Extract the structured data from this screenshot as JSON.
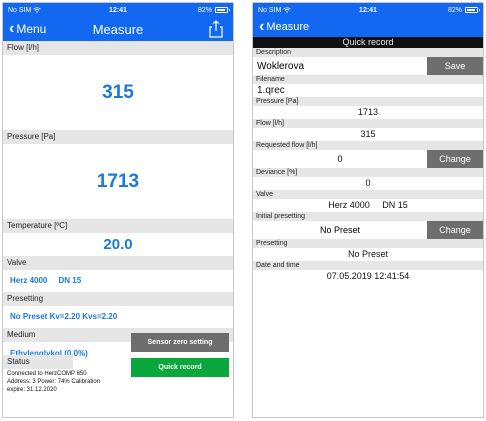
{
  "left": {
    "status": {
      "carrier": "No SIM",
      "time": "12:41",
      "battery": "82%"
    },
    "nav": {
      "back_label": "Menu",
      "title": "Measure"
    },
    "flow": {
      "label": "Flow [l/h]",
      "value": "315"
    },
    "pressure": {
      "label": "Pressure [Pa]",
      "value": "1713"
    },
    "temperature": {
      "label": "Temperature [ºC]",
      "value": "20.0"
    },
    "valve": {
      "label": "Valve",
      "value": "Herz 4000     DN 15"
    },
    "presetting": {
      "label": "Presetting",
      "value": "No Preset Kv=2.20 Kvs=2.20"
    },
    "medium": {
      "label": "Medium",
      "value": "Ethylenglykol (0.0%)"
    },
    "sensor_button": "Sensor zero setting",
    "status_section": {
      "label": "Status",
      "line1": "Connected to HerzCOMP 650",
      "line2": "Address: 3 Power: 74% Calibration",
      "line3": "expire: 31.12.2020"
    },
    "quick_button": "Quick record"
  },
  "right": {
    "status": {
      "carrier": "No SIM",
      "time": "12:41",
      "battery": "82%"
    },
    "nav": {
      "back_label": "Measure"
    },
    "header": "Quick record",
    "description": {
      "label": "Description",
      "value": "Woklerova",
      "button": "Save"
    },
    "filename": {
      "label": "Filename",
      "value": "1.qrec"
    },
    "pressure": {
      "label": "Pressure [Pa]",
      "value": "1713"
    },
    "flow": {
      "label": "Flow [l/h]",
      "value": "315"
    },
    "requested_flow": {
      "label": "Requested flow [l/h]",
      "value": "0",
      "button": "Change"
    },
    "deviance": {
      "label": "Deviance [%]",
      "value": "0"
    },
    "valve": {
      "label": "Valve",
      "value": "Herz 4000     DN 15"
    },
    "initial_presetting": {
      "label": "Initial presetting",
      "value": "No Preset",
      "button": "Change"
    },
    "presetting": {
      "label": "Presetting",
      "value": "No Preset"
    },
    "datetime": {
      "label": "Date and time",
      "value": "07.05.2019 12:41:54"
    }
  },
  "colors": {
    "nav_blue": "#1268f0",
    "value_blue": "#1a78d8",
    "green": "#0aa83c",
    "gray_button": "#6e6e6e"
  },
  "icons": {
    "back": "chevron-left-icon",
    "share": "share-icon",
    "wifi": "wifi-icon",
    "battery": "battery-icon"
  }
}
